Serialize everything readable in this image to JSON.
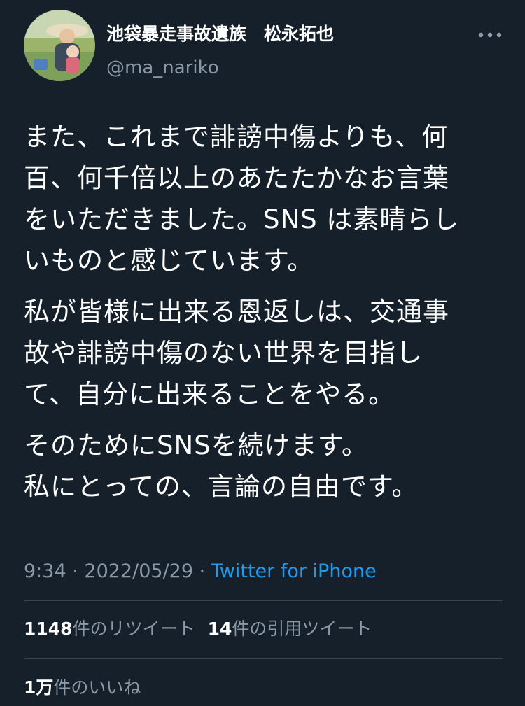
{
  "author": {
    "display_name": "池袋暴走事故遺族　松永拓也",
    "handle": "@ma_nariko",
    "avatar_icon": "profile-photo"
  },
  "more_icon": "more-horizontal-icon",
  "tweet": {
    "paragraphs": [
      "また、これまで誹謗中傷よりも、何\n百、何千倍以上のあたたかなお言葉\nをいただきました。SNS は素晴らし\nいものと感じています。",
      "私が皆様に出来る恩返しは、交通事\n故や誹謗中傷のない世界を目指し\nて、自分に出来ることをやる。",
      "そのためにSNSを続けます。\n私にとっての、言論の自由です。"
    ]
  },
  "meta": {
    "time": "9:34",
    "sep1": " · ",
    "date": "2022/05/29",
    "sep2": " · ",
    "source": "Twitter for iPhone"
  },
  "stats": {
    "retweets_count": "1148",
    "retweets_label": "件のリツイート",
    "quotes_count": "14",
    "quotes_label": "件の引用ツイート",
    "likes_count": "1万",
    "likes_label": "件のいいね"
  },
  "colors": {
    "background": "#15202b",
    "text_primary": "#ffffff",
    "text_secondary": "#8b98a5",
    "link": "#1d9bf0",
    "divider": "#38444d"
  }
}
